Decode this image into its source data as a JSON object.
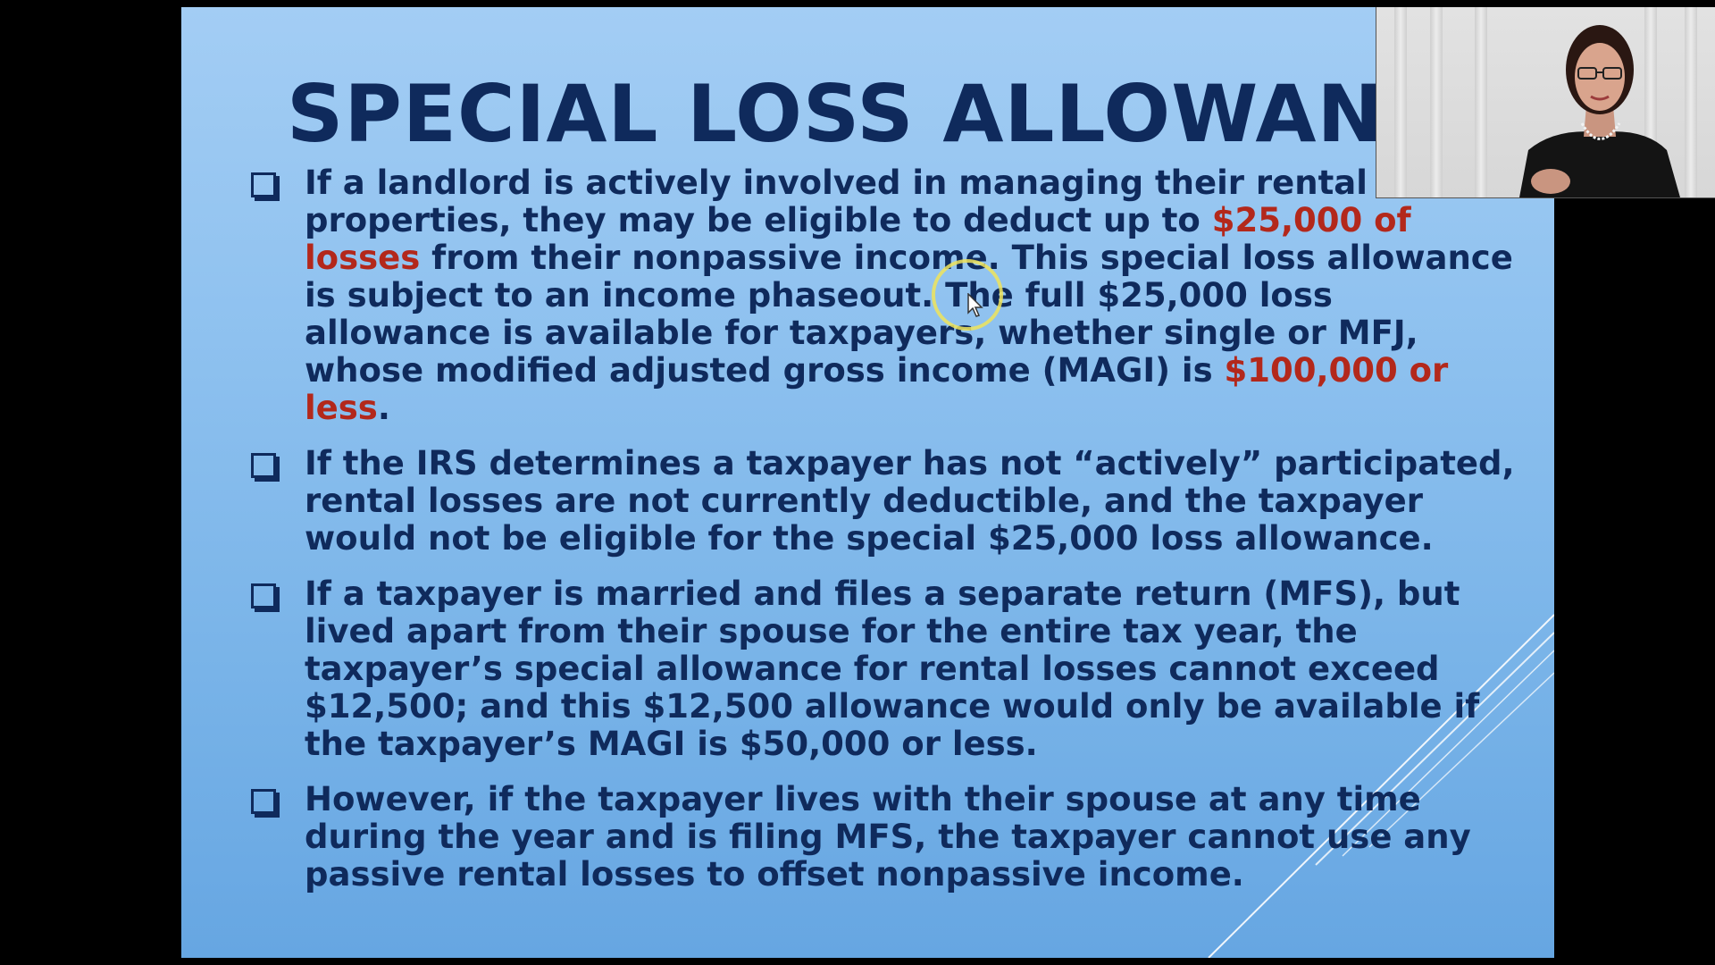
{
  "slide": {
    "title": "SPECIAL LOSS ALLOWANC",
    "bullets": [
      {
        "segments": [
          {
            "text": "If a landlord is actively involved in managing their rental properties, they may be eligible to deduct up to ",
            "highlight": false
          },
          {
            "text": "$25,000 of losses",
            "highlight": true
          },
          {
            "text": " from their nonpassive income. This special loss allowance is subject to an income phaseout. The full $25,000 loss allowance is available for taxpayers, whether single or MFJ, whose modified adjusted gross income (MAGI) is ",
            "highlight": false
          },
          {
            "text": "$100,000 or less",
            "highlight": true
          },
          {
            "text": ".",
            "highlight": false
          }
        ]
      },
      {
        "text": "If the IRS determines a taxpayer has not “actively” participated, rental losses are not currently deductible, and the taxpayer would not be eligible for the special $25,000 loss allowance."
      },
      {
        "text": "If a taxpayer is married and files a separate return (MFS), but lived apart from their spouse for the entire tax year, the taxpayer’s special allowance for rental losses cannot exceed $12,500; and this $12,500 allowance would only be available if the taxpayer’s MAGI is $50,000 or less."
      },
      {
        "text": "However, if the taxpayer lives with their spouse at any time during the year and is filing MFS, the taxpayer cannot use any passive rental losses to offset nonpassive income."
      }
    ]
  },
  "colors": {
    "text": "#0f2a5c",
    "highlight": "#b3281b",
    "slide_top": "#a3cdf4",
    "slide_bottom": "#66a6e2",
    "cursor_ring": "#f0e45a"
  },
  "icons": {
    "bullet": "checkbox-square-icon",
    "cursor": "mouse-pointer-icon"
  }
}
